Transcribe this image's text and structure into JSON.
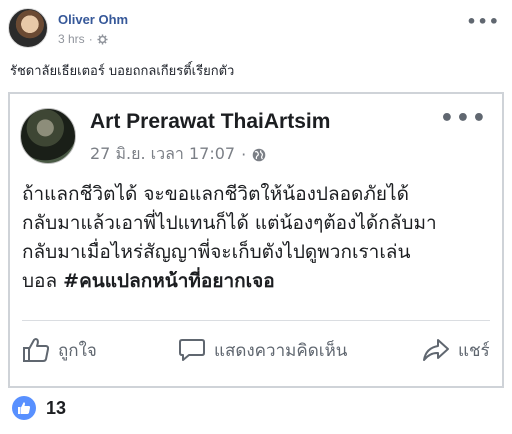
{
  "post": {
    "author": "Oliver Ohm",
    "time": "3 hrs",
    "separator": "·",
    "privacy_icon": "gear-icon",
    "caption": "รัชดาลัยเธียเตอร์ บอยถกลเกียรติ์เรียกตัว",
    "more": "•••"
  },
  "shared": {
    "author": "Art Prerawat ThaiArtsim",
    "date": "27 มิ.ย. เวลา 17:07",
    "separator": "·",
    "privacy_icon": "globe-icon",
    "more": "•••",
    "body_lines": [
      "ถ้าแลกชีวิตได้ จะขอแลกชีวิตให้น้องปลอดภัยได้",
      "กลับมาแล้วเอาพี่ไปแทนก็ได้ แต่น้องๆต้องได้กลับมา",
      "กลับมาเมื่อไหร่สัญญาพี่จะเก็บตังไปดูพวกเราเล่น"
    ],
    "body_last_prefix": "บอล ",
    "hashtag": "#คนแปลกหน้าที่อยากเจอ",
    "actions": {
      "like": "ถูกใจ",
      "comment": "แสดงความคิดเห็น",
      "share": "แชร์"
    }
  },
  "reactions": {
    "icon": "thumbs-up-icon",
    "accent": "#5890ff",
    "count": "13"
  }
}
